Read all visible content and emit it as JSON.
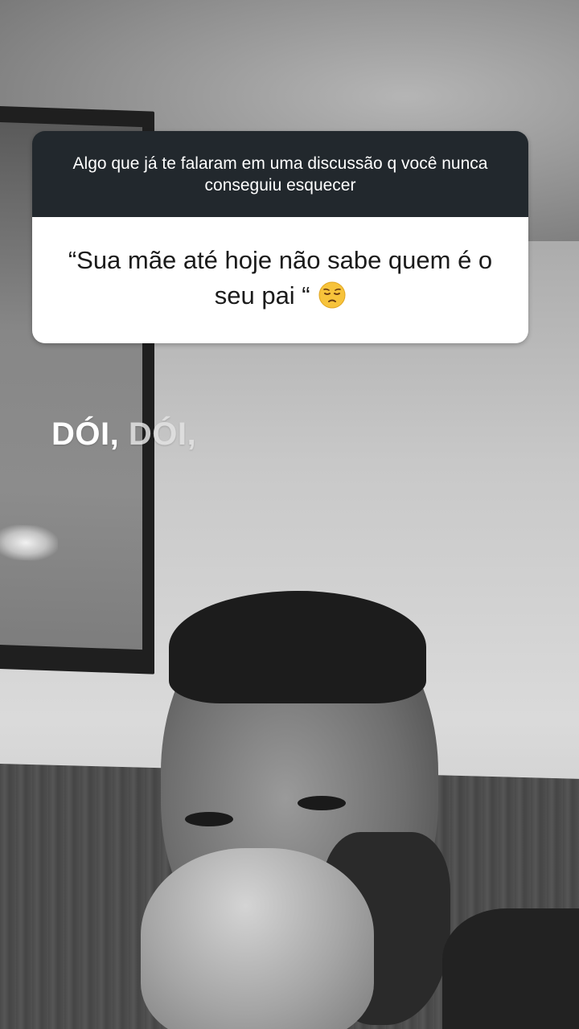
{
  "question_sticker": {
    "prompt": "Algo que já te falaram em uma discussão q você nunca conseguiu esquecer",
    "answer": "“Sua mãe até hoje não sabe quem é o seu pai “",
    "answer_emoji": "pensive-face-emoji",
    "header_color": "#22282d",
    "body_color": "#ffffff"
  },
  "overlay": {
    "word_1": "DÓI,",
    "word_2": "DÓI,"
  }
}
